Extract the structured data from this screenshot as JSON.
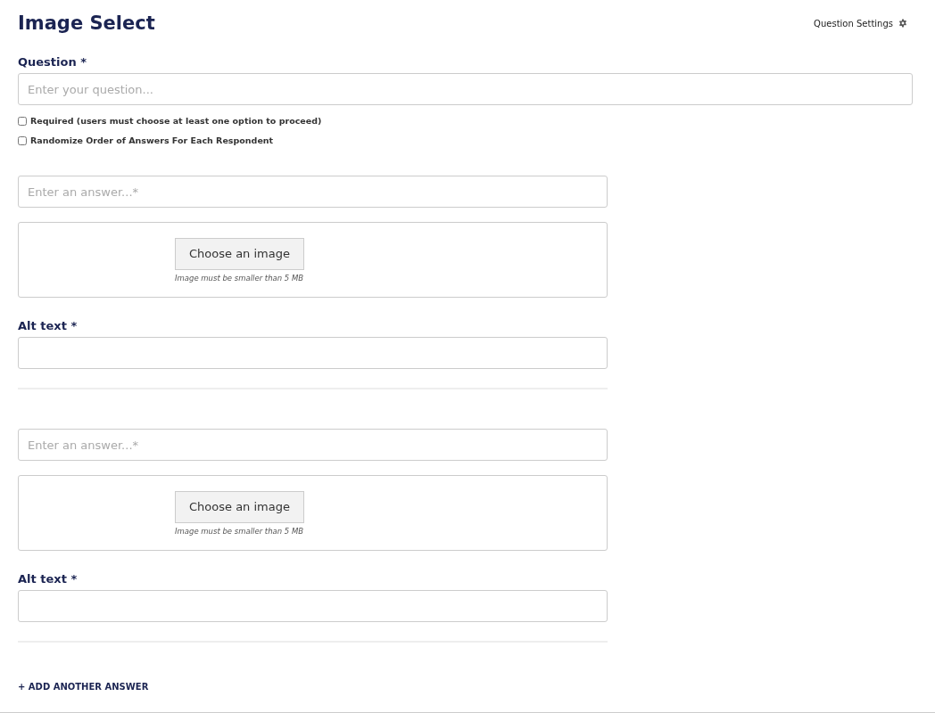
{
  "title": "Image Select",
  "settings_link": "Question Settings",
  "question": {
    "label": "Question *",
    "placeholder": "Enter your question..."
  },
  "options": [
    {
      "label": "Required (users must choose at least one option to proceed)",
      "checked": false
    },
    {
      "label": "Randomize Order of Answers For Each Respondent",
      "checked": false
    }
  ],
  "answers": [
    {
      "placeholder": "Enter an answer...*",
      "image_button": "Choose an image",
      "image_hint": "Image must be smaller than 5 MB",
      "alt_label": "Alt text *"
    },
    {
      "placeholder": "Enter an answer...*",
      "image_button": "Choose an image",
      "image_hint": "Image must be smaller than 5 MB",
      "alt_label": "Alt text *"
    }
  ],
  "add_answer": "+ ADD ANOTHER ANSWER"
}
